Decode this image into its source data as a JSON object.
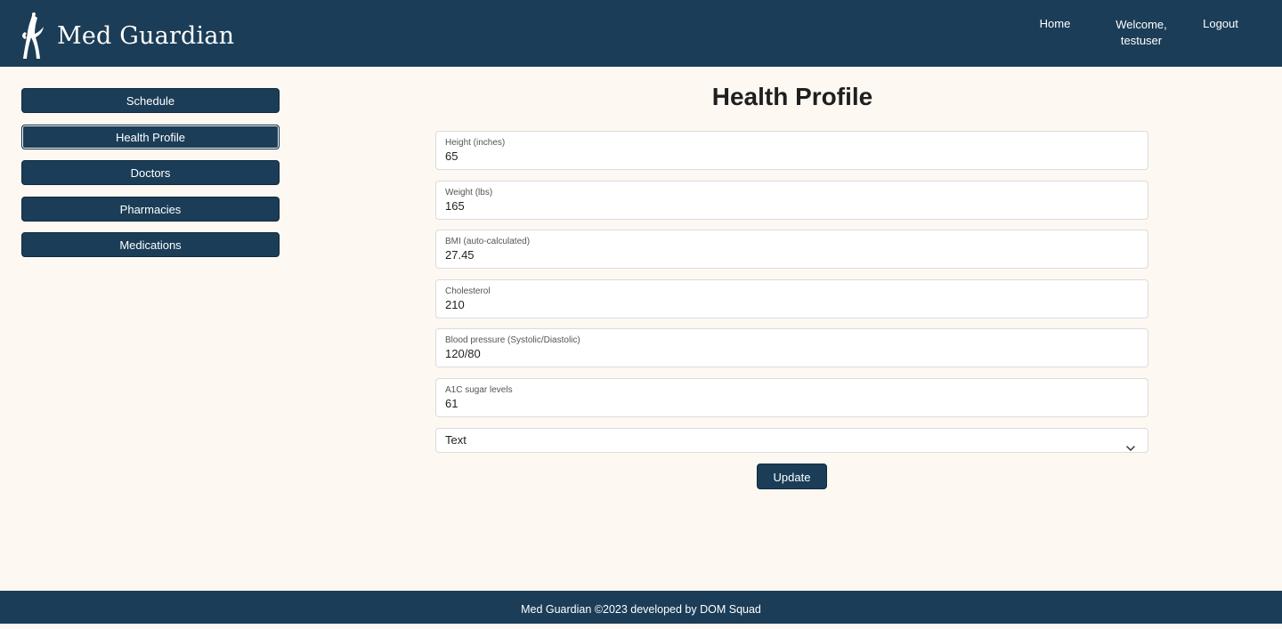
{
  "brand": {
    "name": "Med Guardian",
    "logo_icon": "caduceus-icon"
  },
  "nav": {
    "home": "Home",
    "welcome": "Welcome,",
    "username": "testuser",
    "logout": "Logout"
  },
  "sidebar": {
    "items": [
      {
        "label": "Schedule"
      },
      {
        "label": "Health Profile"
      },
      {
        "label": "Doctors"
      },
      {
        "label": "Pharmacies"
      },
      {
        "label": "Medications"
      }
    ]
  },
  "main": {
    "title": "Health Profile",
    "fields": [
      {
        "label": "Height (inches)",
        "value": "65"
      },
      {
        "label": "Weight (lbs)",
        "value": "165"
      },
      {
        "label": "BMI (auto-calculated)",
        "value": "27.45"
      },
      {
        "label": "Cholesterol",
        "value": "210"
      },
      {
        "label": "Blood pressure (Systolic/Diastolic)",
        "value": "120/80"
      },
      {
        "label": "A1C sugar levels",
        "value": "61"
      }
    ],
    "select": {
      "value": "Text",
      "icon": "chevron-down-icon"
    },
    "update_label": "Update"
  },
  "footer": {
    "text": "Med Guardian ©2023 developed by DOM Squad"
  },
  "colors": {
    "primary": "#1b3d57",
    "background": "#fdf8f2",
    "text": "#1f1f1f"
  }
}
